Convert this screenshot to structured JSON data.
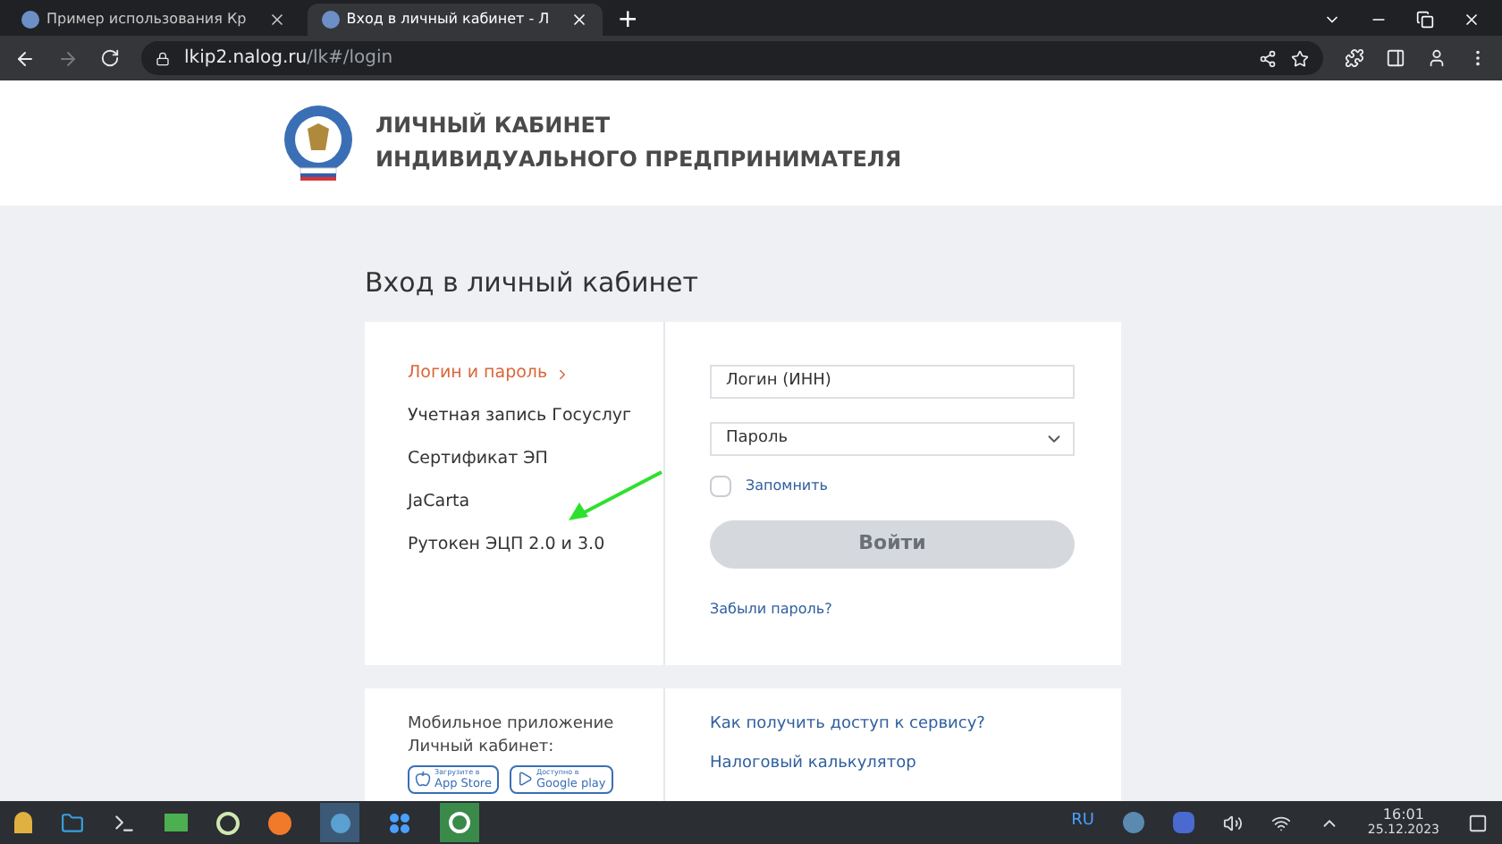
{
  "browser": {
    "tabs": [
      {
        "title": "Пример использования Кр",
        "selected": false
      },
      {
        "title": "Вход в личный кабинет - Л",
        "selected": true
      }
    ],
    "new_tab": "+",
    "address": {
      "host": "lkip2.nalog.ru",
      "path": "/lk#/login"
    }
  },
  "header": {
    "title_line_1": "ЛИЧНЫЙ КАБИНЕТ",
    "title_line_2": "ИНДИВИДУАЛЬНОГО ПРЕДПРИНИМАТЕЛЯ"
  },
  "page_title": "Вход в личный кабинет",
  "login_methods": [
    {
      "label": "Логин и пароль",
      "selected": true
    },
    {
      "label": "Учетная запись Госуслуг",
      "selected": false
    },
    {
      "label": "Сертификат ЭП",
      "selected": false
    },
    {
      "label": "JaCarta",
      "selected": false
    },
    {
      "label": "Рутокен ЭЦП 2.0 и 3.0",
      "selected": false
    }
  ],
  "form": {
    "login": {
      "placeholder": "Логин (ИНН)"
    },
    "password": {
      "placeholder": "Пароль"
    },
    "remember": {
      "label": "Запомнить",
      "checked": false
    },
    "submit": {
      "label": "Войти",
      "disabled": true
    },
    "forgot": "Забыли пароль?"
  },
  "mobile": {
    "text_line_1": "Мобильное приложение",
    "text_line_2": "Личный кабинет:",
    "stores": [
      {
        "kind": "apple",
        "caption": "Загрузите в",
        "name": "App Store"
      },
      {
        "kind": "google",
        "caption": "Доступно в",
        "name": "Google play"
      }
    ]
  },
  "links": [
    "Как получить доступ к сервису?",
    "Налоговый калькулятор"
  ],
  "taskbar": {
    "language": "RU",
    "time": "16:01",
    "date": "25.12.2023"
  }
}
